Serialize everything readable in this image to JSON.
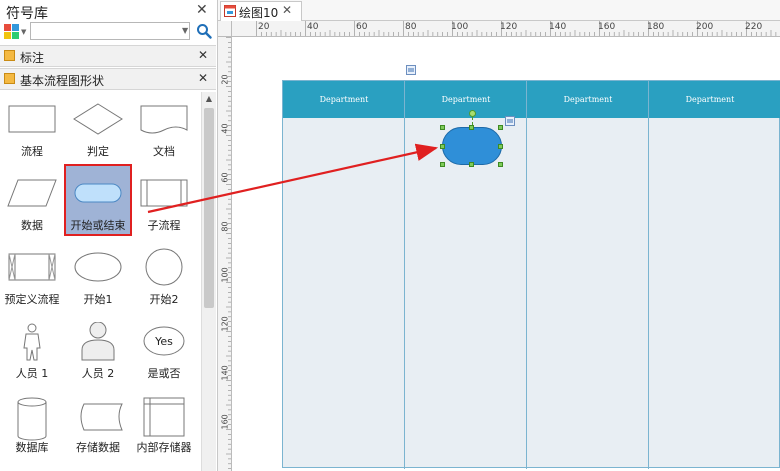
{
  "left_panel": {
    "title": "符号库",
    "close": "✕",
    "search": {
      "value": "",
      "placeholder": ""
    },
    "sections": [
      {
        "label": "标注",
        "close": "✕"
      },
      {
        "label": "基本流程图形状",
        "close": "✕"
      }
    ],
    "shapes": [
      {
        "label": "流程",
        "icon": "process-icon"
      },
      {
        "label": "判定",
        "icon": "decision-icon"
      },
      {
        "label": "文档",
        "icon": "document-icon"
      },
      {
        "label": "数据",
        "icon": "data-icon"
      },
      {
        "label": "开始或结束",
        "icon": "terminator-icon",
        "selected": true
      },
      {
        "label": "子流程",
        "icon": "subprocess-icon"
      },
      {
        "label": "预定义流程",
        "icon": "predefined-process-icon"
      },
      {
        "label": "开始1",
        "icon": "ellipse-icon"
      },
      {
        "label": "开始2",
        "icon": "circle-icon"
      },
      {
        "label": "人员 1",
        "icon": "person-outline-icon"
      },
      {
        "label": "人员 2",
        "icon": "person-bust-icon"
      },
      {
        "label": "是或否",
        "icon": "yes-no-icon",
        "text": "Yes"
      },
      {
        "label": "数据库",
        "icon": "database-icon"
      },
      {
        "label": "存储数据",
        "icon": "stored-data-icon"
      },
      {
        "label": "内部存储器",
        "icon": "internal-storage-icon"
      }
    ]
  },
  "tab": {
    "label": "绘图10",
    "close": "✕"
  },
  "ruler": {
    "h_labels": [
      "20",
      "40",
      "60",
      "80",
      "100",
      "120",
      "140",
      "160",
      "180",
      "200",
      "220"
    ],
    "v_labels": [
      "20",
      "40",
      "60",
      "80",
      "100",
      "120",
      "140",
      "160"
    ]
  },
  "canvas": {
    "lanes": [
      "Department",
      "Department",
      "Department",
      "Department"
    ]
  },
  "colors": {
    "pool_header": "#2aa0c1",
    "pool_body": "#e8eef3",
    "shape_fill": "#2f8fd8",
    "selection": "#9fb3d6",
    "highlight_border": "#e02020",
    "arrow": "#e02020"
  }
}
